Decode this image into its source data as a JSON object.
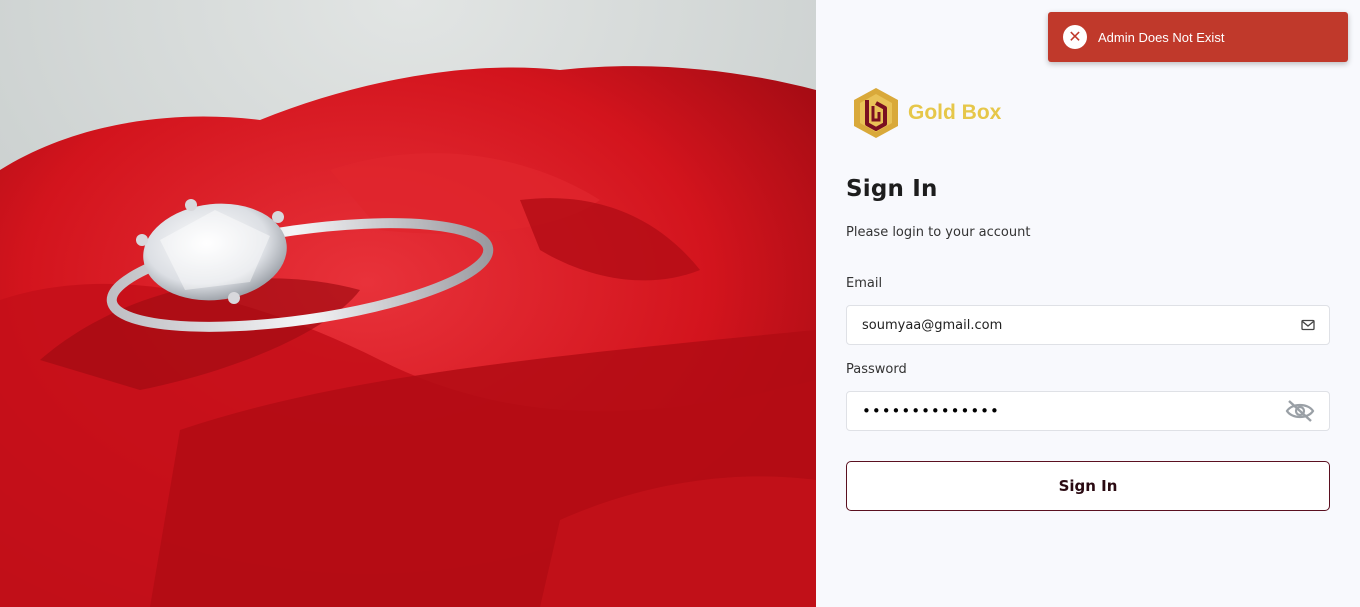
{
  "toast": {
    "message": "Admin Does Not Exist",
    "icon": "close-circle-icon",
    "color": "#c0392b"
  },
  "brand": {
    "name": "Gold Box",
    "color": "#e6c74a"
  },
  "form": {
    "title": "Sign In",
    "subtitle": "Please login to your account",
    "email": {
      "label": "Email",
      "value": "soumyaa@gmail.com",
      "icon": "mail-icon"
    },
    "password": {
      "label": "Password",
      "value": "••••••••••••••",
      "icon": "eye-off-icon"
    },
    "submit_label": "Sign In"
  },
  "hero": {
    "subject": "ring-on-rose-photo",
    "accent": "#d6161c"
  }
}
